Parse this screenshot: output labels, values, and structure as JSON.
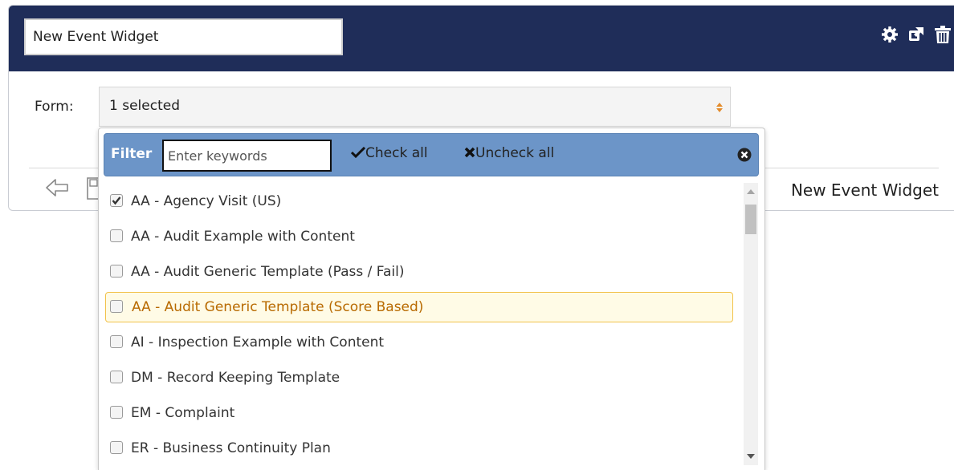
{
  "widget": {
    "title_value": "New Event Widget",
    "footer_title": "New Event Widget",
    "header_icons": [
      "gear-icon",
      "external-link-icon",
      "trash-icon"
    ],
    "header_color": "#1f2d59"
  },
  "form": {
    "label": "Form:",
    "selected_text": "1 selected"
  },
  "dropdown": {
    "filter_label": "Filter",
    "filter_placeholder": "Enter keywords",
    "check_all_label": "Check all",
    "uncheck_all_label": "Uncheck all",
    "accent_color": "#6c95c8",
    "items": [
      {
        "label": "AA - Agency Visit (US)",
        "checked": true,
        "highlighted": false
      },
      {
        "label": "AA - Audit Example with Content",
        "checked": false,
        "highlighted": false
      },
      {
        "label": "AA - Audit Generic Template (Pass / Fail)",
        "checked": false,
        "highlighted": false
      },
      {
        "label": "AA - Audit Generic Template (Score Based)",
        "checked": false,
        "highlighted": true
      },
      {
        "label": "AI - Inspection Example with Content",
        "checked": false,
        "highlighted": false
      },
      {
        "label": "DM - Record Keeping Template",
        "checked": false,
        "highlighted": false
      },
      {
        "label": "EM - Complaint",
        "checked": false,
        "highlighted": false
      },
      {
        "label": "ER - Business Continuity Plan",
        "checked": false,
        "highlighted": false
      }
    ]
  }
}
